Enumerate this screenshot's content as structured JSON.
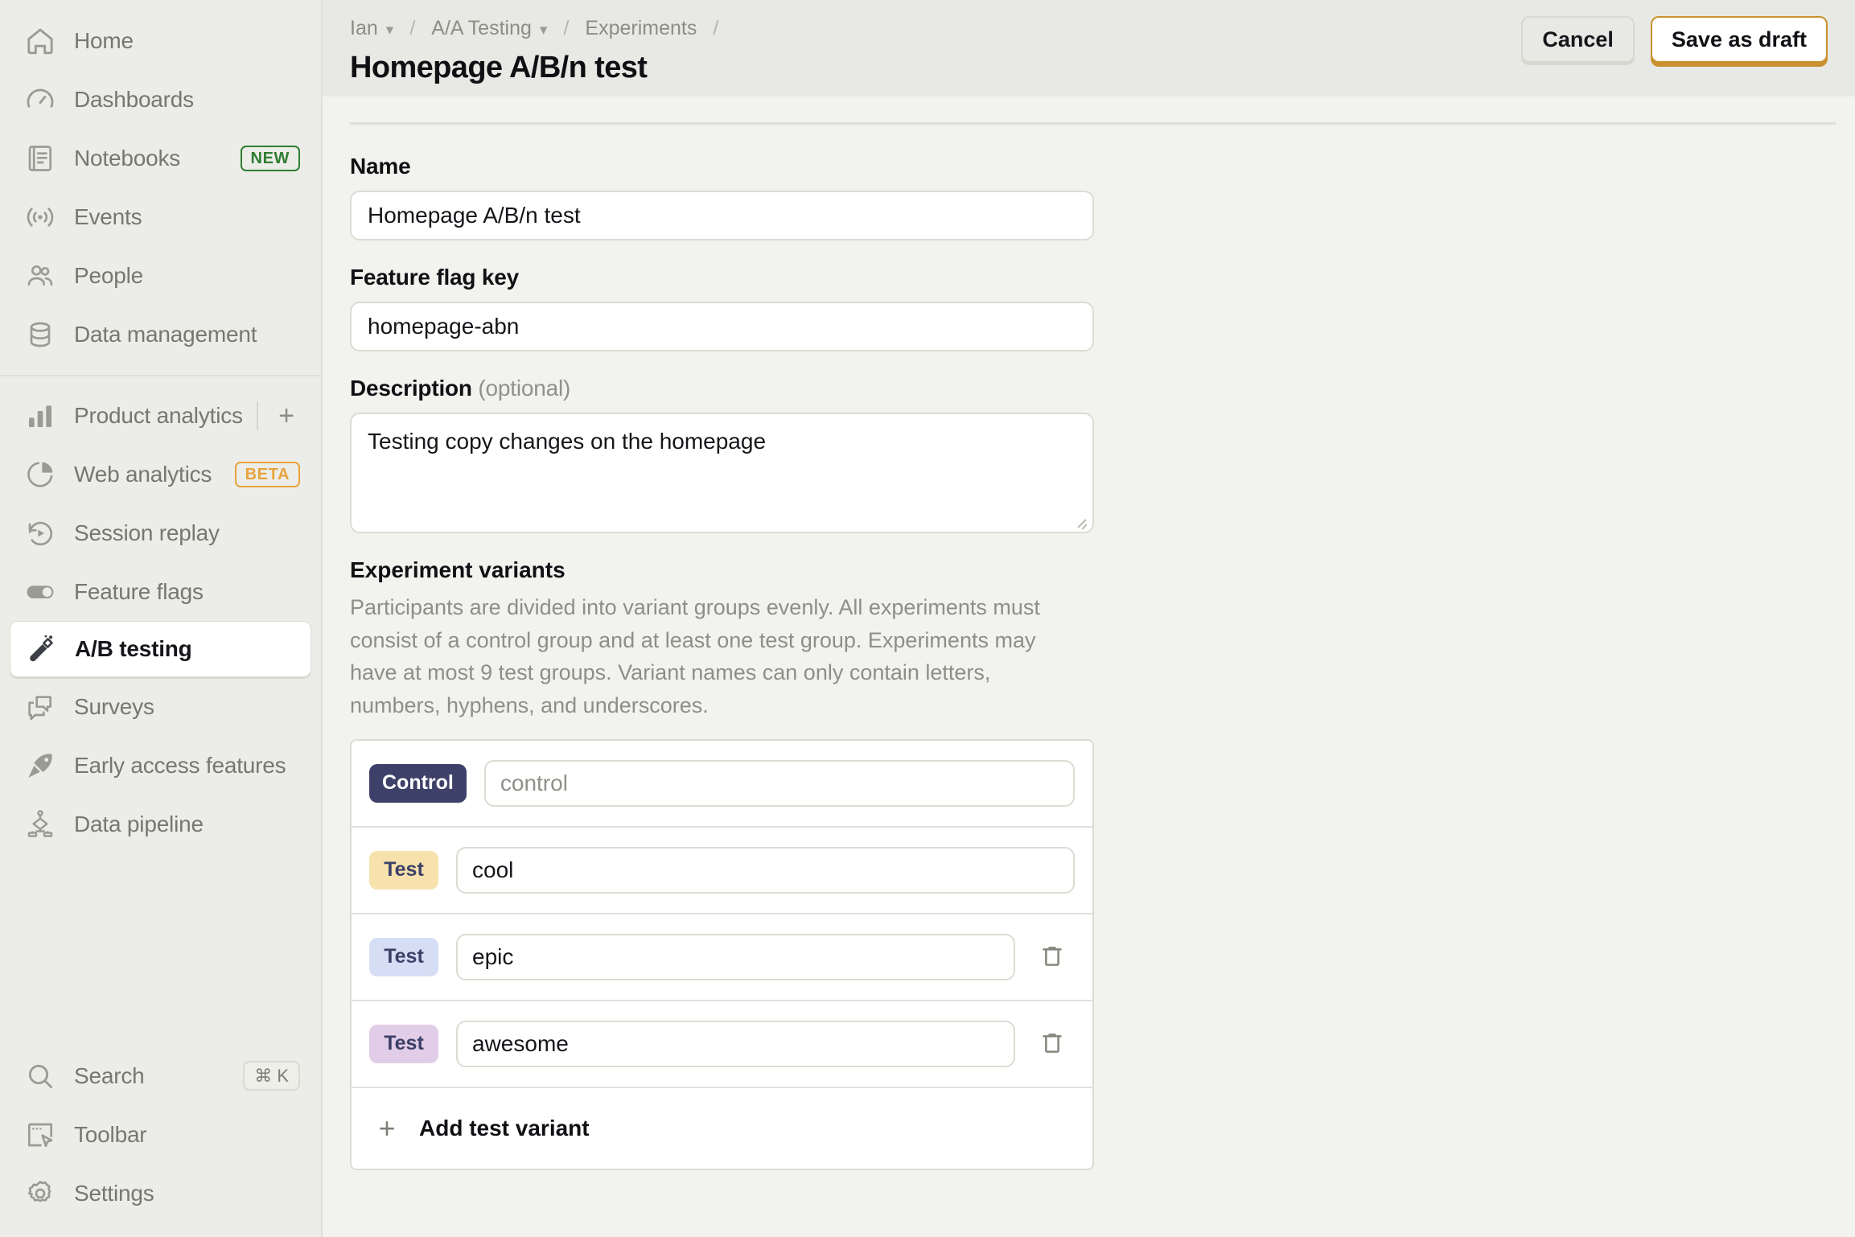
{
  "sidebar": {
    "primary": [
      {
        "label": "Home",
        "icon": "home-icon"
      },
      {
        "label": "Dashboards",
        "icon": "gauge-icon"
      },
      {
        "label": "Notebooks",
        "icon": "notebook-icon",
        "badge": "NEW",
        "badge_kind": "new"
      },
      {
        "label": "Events",
        "icon": "live-events-icon"
      },
      {
        "label": "People",
        "icon": "people-icon"
      },
      {
        "label": "Data management",
        "icon": "database-icon"
      }
    ],
    "products": [
      {
        "label": "Product analytics",
        "icon": "bar-chart-icon",
        "action": "plus-icon"
      },
      {
        "label": "Web analytics",
        "icon": "pie-chart-icon",
        "badge": "BETA",
        "badge_kind": "beta"
      },
      {
        "label": "Session replay",
        "icon": "replay-icon"
      },
      {
        "label": "Feature flags",
        "icon": "toggle-icon"
      },
      {
        "label": "A/B testing",
        "icon": "flask-wand-icon",
        "active": true
      },
      {
        "label": "Surveys",
        "icon": "chat-bubbles-icon"
      },
      {
        "label": "Early access features",
        "icon": "rocket-icon"
      },
      {
        "label": "Data pipeline",
        "icon": "pipeline-icon"
      }
    ],
    "bottom": [
      {
        "label": "Search",
        "icon": "search-icon",
        "shortcut": "⌘ K"
      },
      {
        "label": "Toolbar",
        "icon": "toolbar-icon"
      },
      {
        "label": "Settings",
        "icon": "gear-icon"
      }
    ]
  },
  "header": {
    "breadcrumbs": [
      {
        "label": "Ian",
        "caret": true
      },
      {
        "label": "A/A Testing",
        "caret": true
      },
      {
        "label": "Experiments",
        "caret": false
      }
    ],
    "separator": "/",
    "title": "Homepage A/B/n test",
    "cancel_label": "Cancel",
    "save_label": "Save as draft"
  },
  "form": {
    "name": {
      "label": "Name",
      "value": "Homepage A/B/n test"
    },
    "feature_flag_key": {
      "label": "Feature flag key",
      "value": "homepage-abn"
    },
    "description": {
      "label": "Description",
      "optional": "(optional)",
      "value": "Testing copy changes on the homepage"
    },
    "variants": {
      "title": "Experiment variants",
      "description": "Participants are divided into variant groups evenly. All experiments must consist of a control group and at least one test group. Experiments may have at most 9 test groups. Variant names can only contain letters, numbers, hyphens, and underscores.",
      "rows": [
        {
          "badge": "Control",
          "value": "control",
          "is_placeholder": true,
          "deletable": false,
          "badge_bg": "#3d4068",
          "badge_fg": "#ffffff"
        },
        {
          "badge": "Test",
          "value": "cool",
          "is_placeholder": false,
          "deletable": false,
          "badge_bg": "#f7e2ad",
          "badge_fg": "#3d4068"
        },
        {
          "badge": "Test",
          "value": "epic",
          "is_placeholder": false,
          "deletable": true,
          "badge_bg": "#d6def5",
          "badge_fg": "#3d4068"
        },
        {
          "badge": "Test",
          "value": "awesome",
          "is_placeholder": false,
          "deletable": true,
          "badge_bg": "#e2cde8",
          "badge_fg": "#3d4068"
        }
      ],
      "add_label": "Add test variant",
      "add_icon": "plus-icon",
      "delete_icon": "trash-icon"
    }
  },
  "colors": {
    "sidebar_bg": "#ecede8",
    "content_bg": "#f2f2ef",
    "topbar_bg": "#e8e9e4",
    "accent": "#c9912f",
    "badge_new": "#2f7d32",
    "badge_beta": "#e8a33d"
  }
}
